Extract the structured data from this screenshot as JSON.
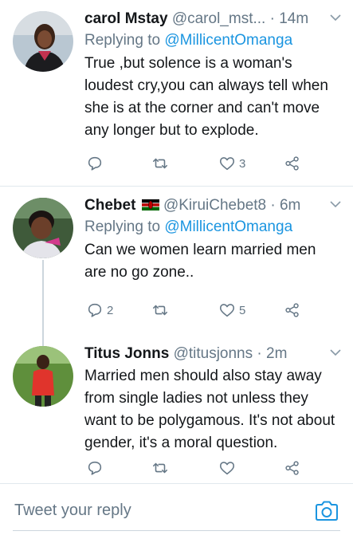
{
  "tweets": [
    {
      "name": "carol Mstay",
      "handle_time": "@carol_mst... · 14m",
      "replying_prefix": "Replying to",
      "replying_handle": "@MillicentOmanga",
      "text": "True ,but solence is a woman's loudest cry,you can always tell when she is at the corner and can't move any longer but to explode.",
      "reply_count": "",
      "retweet_count": "",
      "like_count": "3"
    },
    {
      "name": "Chebet",
      "flag": "🇰🇪",
      "handle_time": "@KiruiChebet8 · 6m",
      "replying_prefix": "Replying to",
      "replying_handle": "@MillicentOmanga",
      "text": "Can we women learn married men are no go zone..",
      "reply_count": "2",
      "retweet_count": "",
      "like_count": "5"
    },
    {
      "name": "Titus Jonns",
      "handle_time": "@titusjonns · 2m",
      "text": "Married men should also stay away from single ladies not unless they want to be polygamous. It's not about gender, it's a moral question.",
      "reply_count": "",
      "retweet_count": "",
      "like_count": ""
    }
  ],
  "reply_bar": {
    "placeholder": "Tweet your reply",
    "icon": "camera-icon"
  },
  "colors": {
    "accent": "#1b95e0",
    "muted": "#657786",
    "text": "#14171a",
    "divider": "#e1e8ed"
  }
}
